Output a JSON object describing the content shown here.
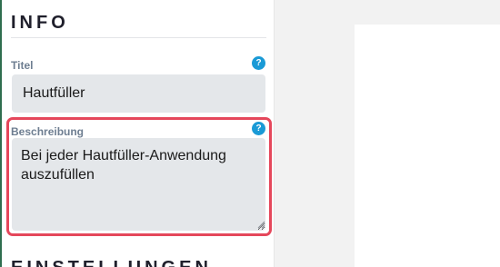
{
  "info_section": {
    "title": "INFO",
    "fields": {
      "title": {
        "label": "Titel",
        "value": "Hautfüller",
        "help": "?"
      },
      "description": {
        "label": "Beschreibung",
        "value": "Bei jeder Hautfüller-Anwendung\nauszufüllen",
        "help": "?"
      }
    }
  },
  "next_section": {
    "title": "EINSTELLUNGEN"
  },
  "colors": {
    "accent": "#2f6e4f",
    "help_icon": "#1a9ad6",
    "highlight_border": "#e5475b",
    "input_bg": "#e4e7ea",
    "label": "#6e7e91"
  }
}
